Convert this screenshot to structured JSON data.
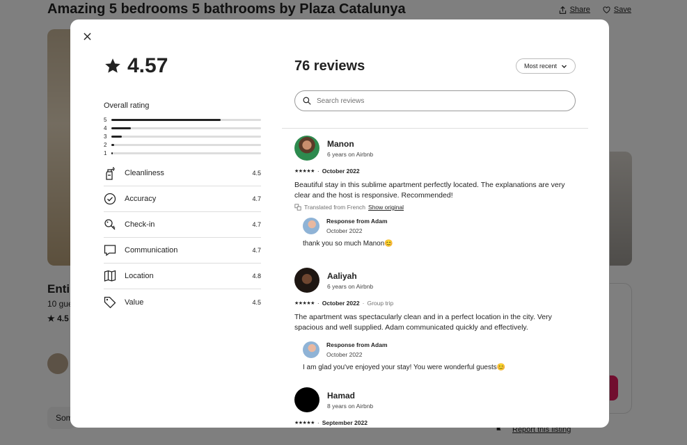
{
  "background": {
    "listing_title": "Amazing 5 bedrooms 5 bathrooms by Plaza Catalunya",
    "share_label": "Share",
    "save_label": "Save",
    "subtitle_partial": "Enti",
    "guests_partial": "10 gue",
    "rating_partial": "4.5",
    "button_partial": "Som",
    "report_label": "Report this listing"
  },
  "modal": {
    "overall_score": "4.57",
    "overall_label": "Overall rating",
    "distribution": [
      {
        "stars": "5",
        "fraction": 0.73
      },
      {
        "stars": "4",
        "fraction": 0.13
      },
      {
        "stars": "3",
        "fraction": 0.07
      },
      {
        "stars": "2",
        "fraction": 0.02
      },
      {
        "stars": "1",
        "fraction": 0.01
      }
    ],
    "categories": [
      {
        "icon": "spray-bottle-icon",
        "label": "Cleanliness",
        "value": "4.5"
      },
      {
        "icon": "check-circle-icon",
        "label": "Accuracy",
        "value": "4.7"
      },
      {
        "icon": "key-icon",
        "label": "Check-in",
        "value": "4.7"
      },
      {
        "icon": "message-icon",
        "label": "Communication",
        "value": "4.7"
      },
      {
        "icon": "map-icon",
        "label": "Location",
        "value": "4.8"
      },
      {
        "icon": "tag-icon",
        "label": "Value",
        "value": "4.5"
      }
    ],
    "reviews_count": "76 reviews",
    "sort_label": "Most recent",
    "search_placeholder": "Search reviews",
    "reviews": [
      {
        "name": "Manon",
        "tenure": "6 years on Airbnb",
        "stars": "★★★★★",
        "date": "October 2022",
        "trip": "",
        "text": "Beautiful stay in this sublime apartment perfectly located. The explanations are very clear and the host is responsive. Recommended!",
        "translated": "Translated from French",
        "show_original": "Show original",
        "response_from": "Response from Adam",
        "response_date": "October 2022",
        "response_text": "thank you so much Manon😊"
      },
      {
        "name": "Aaliyah",
        "tenure": "6 years on Airbnb",
        "stars": "★★★★★",
        "date": "October 2022",
        "trip": "Group trip",
        "text": "The apartment was spectacularly clean and in a perfect location in the city. Very spacious and well supplied. Adam communicated quickly and effectively.",
        "response_from": "Response from Adam",
        "response_date": "October 2022",
        "response_text": "I am glad you've enjoyed your stay! You were wonderful guests😊"
      },
      {
        "name": "Hamad",
        "tenure": "8 years on Airbnb",
        "stars": "★★★★★",
        "date": "September 2022"
      }
    ]
  },
  "colors": {
    "accent": "#e31c5f",
    "text": "#222222",
    "muted": "#717171",
    "divider": "#dddddd"
  }
}
